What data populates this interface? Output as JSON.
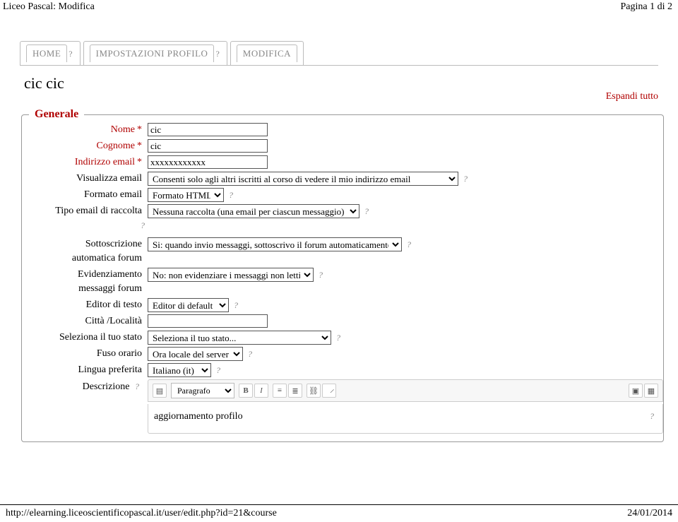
{
  "page": {
    "header_title": "Liceo Pascal: Modifica",
    "page_indicator": "Pagina 1 di 2",
    "footer_url": "http://elearning.liceoscientificopascal.it/user/edit.php?id=21&course",
    "footer_date": "24/01/2014"
  },
  "tabs": {
    "home": "HOME",
    "settings": "IMPOSTAZIONI PROFILO",
    "edit": "MODIFICA"
  },
  "title": "cic cic",
  "expand_all": "Espandi tutto",
  "legend": "Generale",
  "labels": {
    "nome": "Nome",
    "cognome": "Cognome",
    "email": "Indirizzo email",
    "visualizza_email": "Visualizza email",
    "formato_email": "Formato email",
    "tipo_raccolta": "Tipo email di raccolta",
    "sottoscrizione1": "Sottoscrizione",
    "sottoscrizione2": "automatica forum",
    "evidenziamento1": "Evidenziamento",
    "evidenziamento2": "messaggi forum",
    "editor_testo": "Editor di testo",
    "citta": "Città /Località",
    "stato": "Seleziona il tuo stato",
    "fuso": "Fuso orario",
    "lingua": "Lingua preferita",
    "descrizione": "Descrizione"
  },
  "values": {
    "nome": "cic",
    "cognome": "cic",
    "email": "xxxxxxxxxxxx",
    "visualizza_email": "Consenti solo agli altri iscritti al corso di vedere il mio indirizzo email",
    "formato_email": "Formato HTML",
    "tipo_raccolta": "Nessuna raccolta (una email per ciascun messaggio)",
    "sottoscrizione": "Si: quando invio messaggi, sottoscrivo il forum automaticamente",
    "evidenziamento": "No: non evidenziare i messaggi non letti",
    "editor_testo": "Editor di default",
    "citta": "",
    "stato": "Seleziona il tuo stato...",
    "fuso": "Ora locale del server",
    "lingua": "Italiano (it)"
  },
  "editor": {
    "paragraph": "Paragrafo",
    "content": "aggiornamento profilo"
  }
}
